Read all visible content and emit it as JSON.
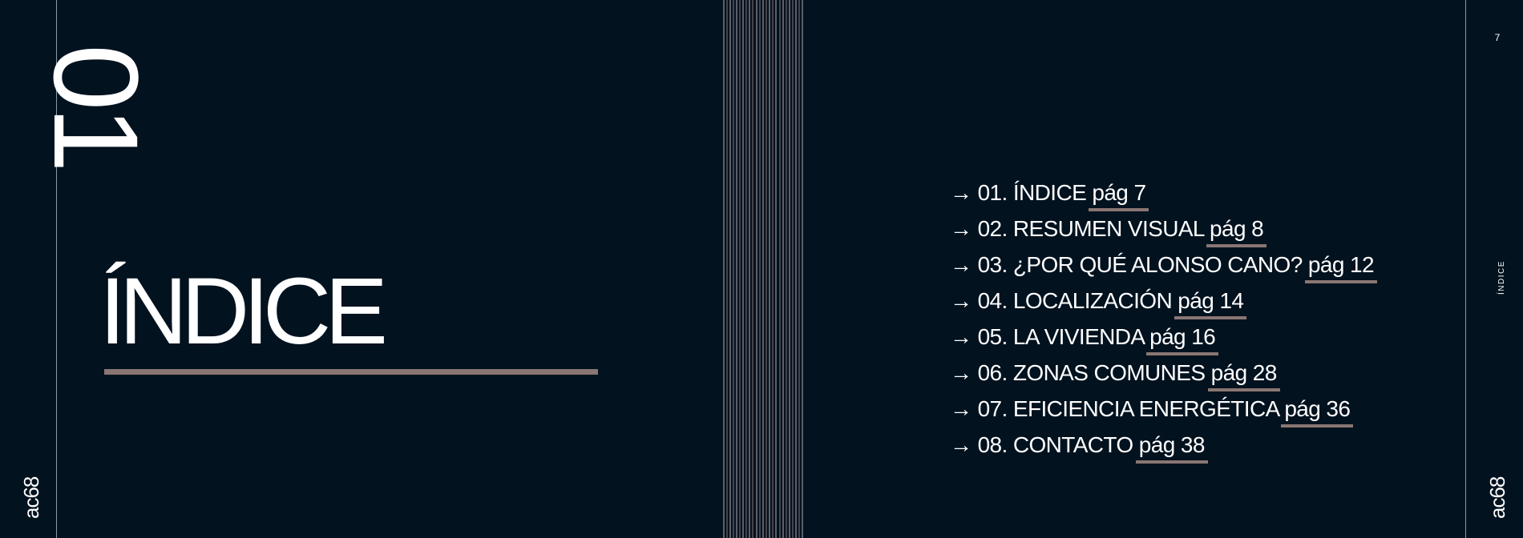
{
  "brand": "ac68",
  "section_number": "01",
  "page_heading": "ÍNDICE",
  "page_number": "7",
  "side_label": "ÍNDICE",
  "colors": {
    "background": "#02121f",
    "accent": "#8a7673",
    "text": "#ffffff"
  },
  "toc": [
    {
      "label": "→ 01. ÍNDICE ",
      "page": "pág 7"
    },
    {
      "label": "→ 02. RESUMEN VISUAL  ",
      "page": "pág 8"
    },
    {
      "label": "→ 03. ¿POR QUÉ ALONSO CANO? ",
      "page": "pág 12"
    },
    {
      "label": "→ 04. LOCALIZACIÓN ",
      "page": "pág 14"
    },
    {
      "label": "→ 05. LA VIVIENDA ",
      "page": "pág 16"
    },
    {
      "label": "→ 06. ZONAS COMUNES ",
      "page": "pág 28"
    },
    {
      "label": "→ 07. EFICIENCIA ENERGÉTICA ",
      "page": "pág 36"
    },
    {
      "label": "→ 08. CONTACTO ",
      "page": "pág 38"
    }
  ]
}
